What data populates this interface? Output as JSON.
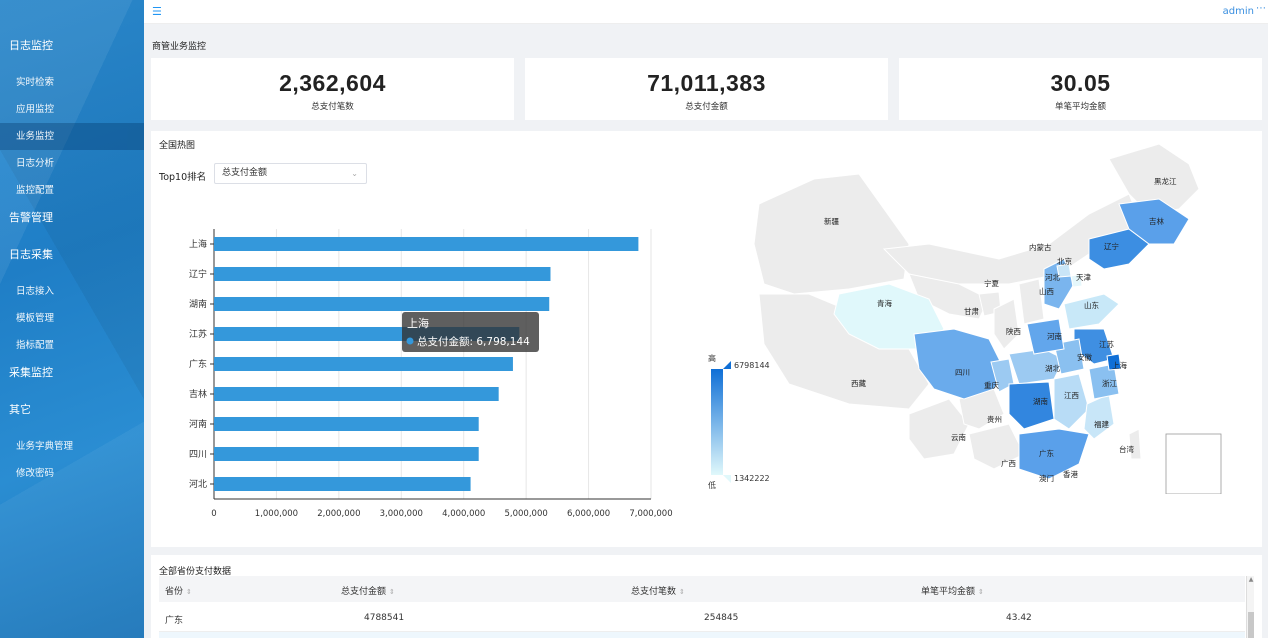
{
  "topbar": {
    "user": "admin",
    "more": "⋯"
  },
  "sidebar": {
    "groups": [
      {
        "label": "日志监控",
        "items": [
          "实时检索",
          "应用监控",
          "业务监控",
          "日志分析",
          "监控配置"
        ]
      },
      {
        "label": "告警管理",
        "items": []
      },
      {
        "label": "日志采集",
        "items": [
          "日志接入",
          "模板管理",
          "指标配置"
        ]
      },
      {
        "label": "采集监控",
        "items": []
      },
      {
        "label": "其它",
        "items": [
          "业务字典管理",
          "修改密码"
        ]
      }
    ],
    "active_item": "业务监控"
  },
  "page": {
    "title": "商管业务监控"
  },
  "stats": [
    {
      "value": "2,362,604",
      "label": "总支付笔数"
    },
    {
      "value": "71,011,383",
      "label": "总支付金额"
    },
    {
      "value": "30.05",
      "label": "单笔平均金额"
    }
  ],
  "heatmap": {
    "title": "全国热图",
    "rank_label": "Top10排名",
    "select_value": "总支付金额",
    "tooltip": {
      "name": "上海",
      "series": "总支付金额",
      "value": "6,798,144"
    },
    "legend": {
      "high": "高",
      "low": "低",
      "max": "6798144",
      "min": "1342222"
    },
    "map_labels": [
      "黑龙江",
      "吉林",
      "辽宁",
      "新疆",
      "内蒙古",
      "北京",
      "天津",
      "河北",
      "宁夏",
      "山西",
      "青海",
      "甘肃",
      "山东",
      "陕西",
      "河南",
      "江苏",
      "安徽",
      "上海",
      "西藏",
      "四川",
      "重庆",
      "湖北",
      "浙江",
      "湖南",
      "江西",
      "贵州",
      "福建",
      "云南",
      "台湾",
      "广西",
      "广东",
      "澳门",
      "香港"
    ]
  },
  "chart_data": {
    "type": "bar",
    "orientation": "horizontal",
    "categories": [
      "上海",
      "辽宁",
      "湖南",
      "江苏",
      "广东",
      "吉林",
      "河南",
      "四川",
      "河北"
    ],
    "values": [
      6798144,
      5390000,
      5370000,
      4890000,
      4788541,
      4560000,
      4240000,
      4240000,
      4110000
    ],
    "xlim": [
      0,
      7000000
    ],
    "ticks": [
      "0",
      "1,000,000",
      "2,000,000",
      "3,000,000",
      "4,000,000",
      "5,000,000",
      "6,000,000",
      "7,000,000"
    ],
    "series_name": "总支付金额",
    "color": "#3498db",
    "grid": true
  },
  "table": {
    "title": "全部省份支付数据",
    "columns": [
      "省份",
      "总支付金额",
      "总支付笔数",
      "单笔平均金额"
    ],
    "rows": [
      [
        "广东",
        "4788541",
        "254845",
        "43.42"
      ]
    ]
  },
  "colors": {
    "accent": "#2196f3",
    "bar": "#3498db",
    "map_high": "#0f6fd6",
    "map_low": "#e0f8fb",
    "map_none": "#ececec"
  }
}
